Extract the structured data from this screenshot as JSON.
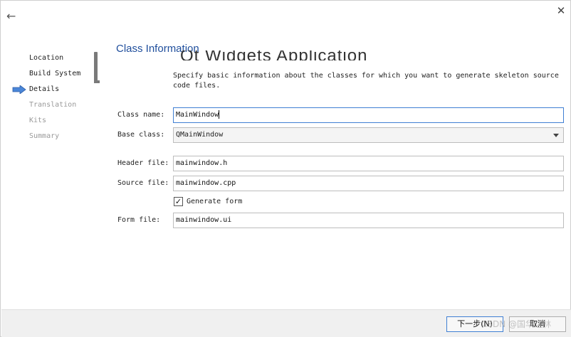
{
  "window": {
    "back_icon": "left-arrow-icon",
    "close_icon": "close-icon"
  },
  "sidebar": {
    "items": [
      {
        "label": "Location",
        "state": "done"
      },
      {
        "label": "Build System",
        "state": "done"
      },
      {
        "label": "Details",
        "state": "current"
      },
      {
        "label": "Translation",
        "state": "pending"
      },
      {
        "label": "Kits",
        "state": "pending"
      },
      {
        "label": "Summary",
        "state": "pending"
      }
    ],
    "current_marker_icon": "right-arrow-icon",
    "marker_color": "#4a86d8"
  },
  "main": {
    "title": "Class Information",
    "ghost_heading": "Qt Widgets Application",
    "description": "Specify basic information about the classes for which you want to generate skeleton source code files.",
    "class_name_label": "Class name:",
    "class_name_value": "MainWindow",
    "base_class_label": "Base class:",
    "base_class_value": "QMainWindow",
    "header_file_label": "Header file:",
    "header_file_value": "mainwindow.h",
    "source_file_label": "Source file:",
    "source_file_value": "mainwindow.cpp",
    "generate_form_label": "Generate form",
    "generate_form_checked": true,
    "form_file_label": "Form file:",
    "form_file_value": "mainwindow.ui"
  },
  "footer": {
    "next_label": "下一步(N)",
    "cancel_label": "取消",
    "watermark": "CSDN @国华之林"
  },
  "colors": {
    "title": "#1f4e9c",
    "focus_border": "#3f7fd3",
    "inactive_text": "#9a9a9a"
  }
}
